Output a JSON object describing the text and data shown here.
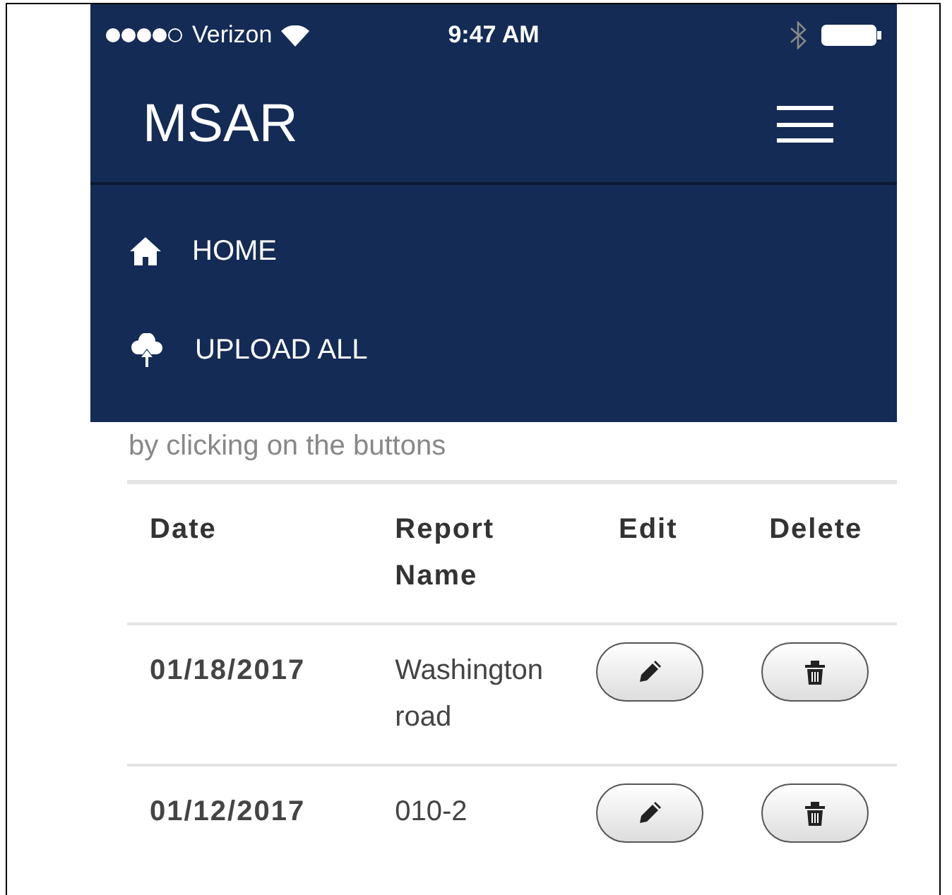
{
  "status_bar": {
    "carrier": "Verizon",
    "time": "9:47 AM"
  },
  "header": {
    "title": "MSAR"
  },
  "menu": {
    "items": [
      {
        "label": "HOME",
        "kind": "home"
      },
      {
        "label": "UPLOAD ALL",
        "kind": "upload"
      }
    ]
  },
  "intro": "by clicking on the buttons",
  "table": {
    "columns": [
      "Date",
      "Report Name",
      "Edit",
      "Delete"
    ],
    "rows": [
      {
        "date": "01/18/2017",
        "name": "Washington road"
      },
      {
        "date": "01/12/2017",
        "name": "010-2"
      }
    ]
  }
}
